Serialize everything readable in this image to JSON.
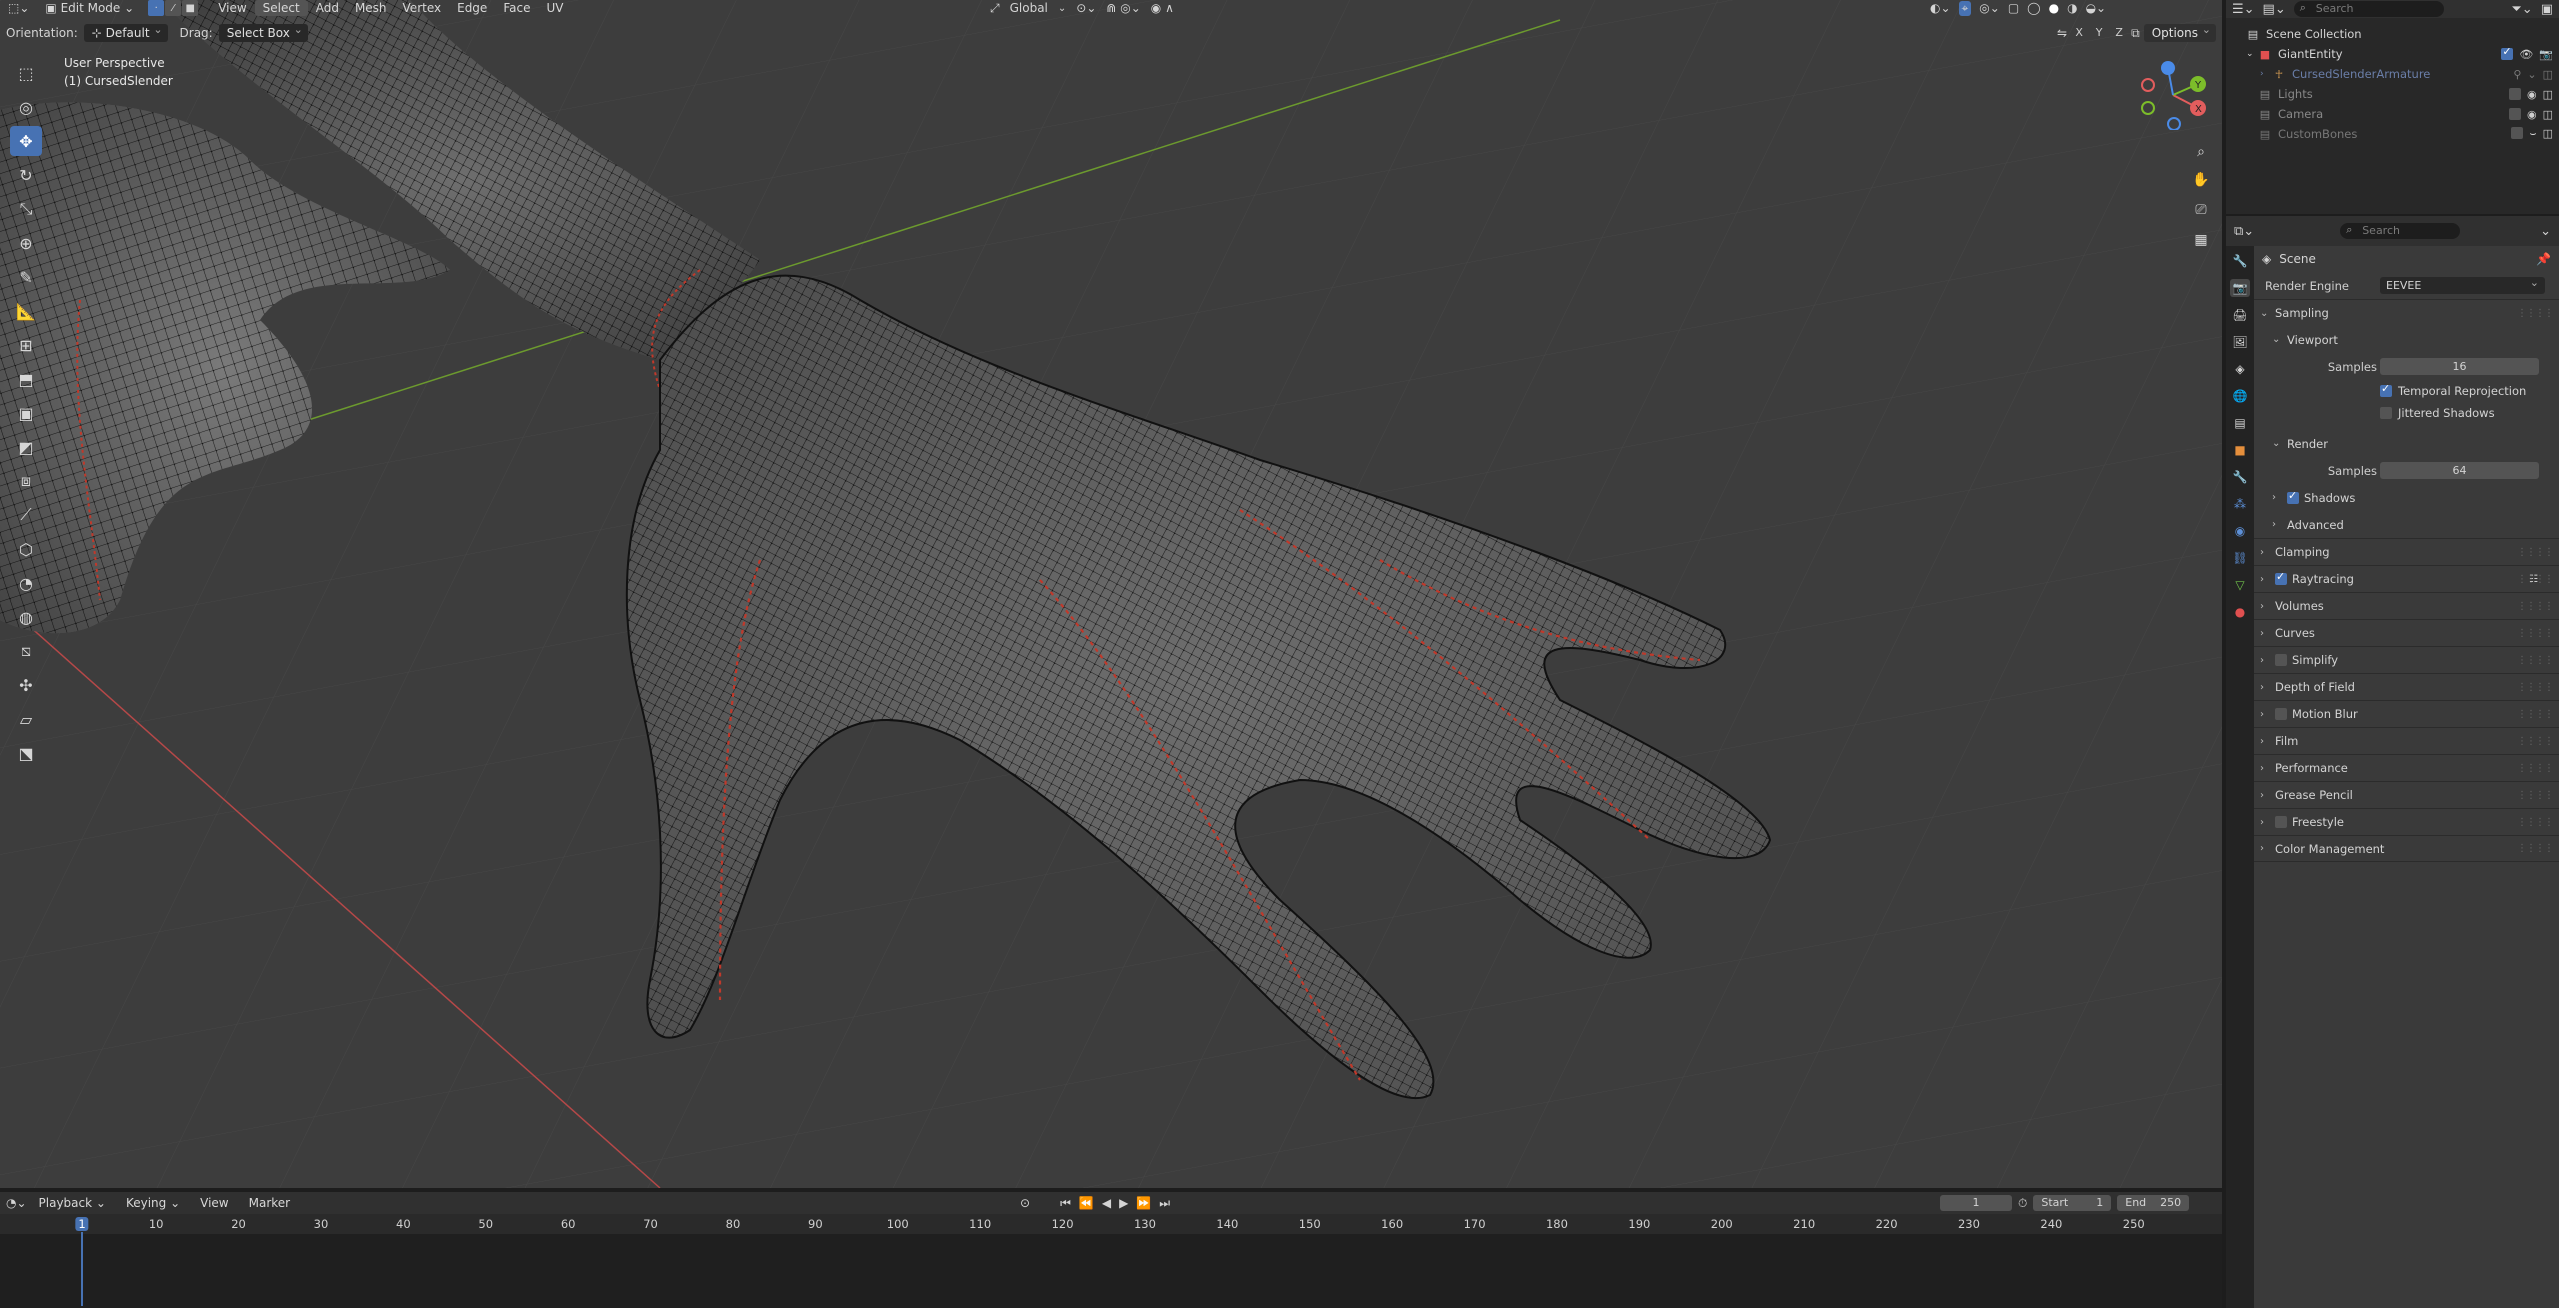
{
  "viewport_header": {
    "mode": "Edit Mode",
    "menus": [
      "View",
      "Select",
      "Add",
      "Mesh",
      "Vertex",
      "Edge",
      "Face",
      "UV"
    ],
    "active_menu": "Select",
    "transform_orientation": "Global",
    "options_label": "Options",
    "axis_labels": [
      "X",
      "Y",
      "Z"
    ]
  },
  "tool_settings": {
    "orientation_label": "Orientation:",
    "orientation_value": "Default",
    "drag_label": "Drag:",
    "drag_value": "Select Box"
  },
  "viewport_info": {
    "perspective": "User Perspective",
    "object": "(1) CursedSlender"
  },
  "toolbar": {
    "tools": [
      "select-box",
      "cursor",
      "move",
      "rotate",
      "scale",
      "transform",
      "annotate",
      "measure",
      "add-cube",
      "extrude",
      "inset",
      "bevel",
      "loop-cut",
      "knife",
      "poly-build",
      "spin",
      "smooth",
      "edge-slide",
      "shrink-fatten",
      "shear",
      "rip-region"
    ],
    "active": "move"
  },
  "outliner": {
    "search_placeholder": "Search",
    "items": [
      {
        "label": "Scene Collection",
        "icon": "collection",
        "depth": 0
      },
      {
        "label": "GiantEntity",
        "icon": "collection",
        "depth": 1,
        "selected": true
      },
      {
        "label": "CursedSlenderArmature",
        "icon": "armature",
        "depth": 2
      },
      {
        "label": "Lights",
        "icon": "collection",
        "depth": 1
      },
      {
        "label": "Camera",
        "icon": "collection",
        "depth": 1
      },
      {
        "label": "CustomBones",
        "icon": "collection",
        "depth": 1
      }
    ]
  },
  "properties": {
    "search_placeholder": "Search",
    "context": "Scene",
    "render_engine_label": "Render Engine",
    "render_engine_value": "EEVEE",
    "sampling": {
      "label": "Sampling",
      "viewport_label": "Viewport",
      "samples_label": "Samples",
      "viewport_samples": "16",
      "temporal_reprojection": "Temporal Reprojection",
      "jittered_shadows": "Jittered Shadows",
      "render_label": "Render",
      "render_samples": "64",
      "shadows": "Shadows",
      "advanced": "Advanced"
    },
    "panels": [
      "Clamping",
      "Raytracing",
      "Volumes",
      "Curves",
      "Simplify",
      "Depth of Field",
      "Motion Blur",
      "Film",
      "Performance",
      "Grease Pencil",
      "Freestyle",
      "Color Management"
    ]
  },
  "timeline": {
    "menus": [
      "Playback",
      "Keying",
      "View",
      "Marker"
    ],
    "current_frame": "1",
    "start_label": "Start",
    "start_value": "1",
    "end_label": "End",
    "end_value": "250",
    "ruler": [
      "1",
      "10",
      "20",
      "30",
      "40",
      "50",
      "60",
      "70",
      "80",
      "90",
      "100",
      "110",
      "120",
      "130",
      "140",
      "150",
      "160",
      "170",
      "180",
      "190",
      "200",
      "210",
      "220",
      "230",
      "240",
      "250"
    ]
  },
  "colors": {
    "accent": "#4772b3",
    "viewport_bg": "#3d3d3d",
    "seam": "#c0392b",
    "x_axis": "#b54848",
    "y_axis": "#6c9a2e"
  }
}
